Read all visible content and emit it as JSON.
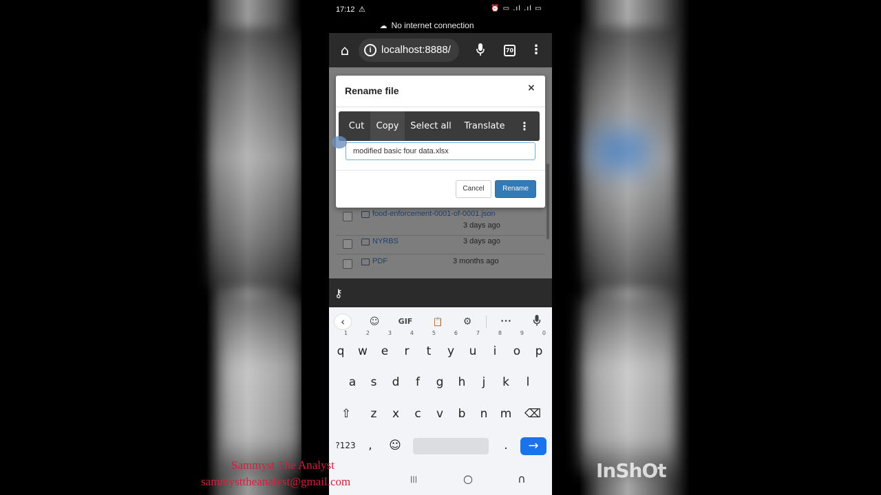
{
  "status_bar": {
    "time": "17:12",
    "warning_glyph": "⚠",
    "right_icons": "⏰ ▭ .ıl .ıl ▭"
  },
  "network_banner": {
    "icon": "cloud-off-icon",
    "text": "No internet connection"
  },
  "browser": {
    "url": "localhost:8888/",
    "tab_count": "70",
    "home_glyph": "⌂",
    "mic_glyph": "🎤",
    "menu_glyph": "⋮",
    "info_glyph": "i"
  },
  "file_list": [
    {
      "name": "food-enforcement-0001-of-0001.json",
      "modified": "3 days ago"
    },
    {
      "name": "NYRBS",
      "modified": "3 days ago"
    },
    {
      "name": "PDF",
      "modified": "3 months ago"
    }
  ],
  "dialog": {
    "title": "Rename file",
    "close_glyph": "×",
    "input_value": "modified basic four data.xlsx",
    "cancel_label": "Cancel",
    "rename_label": "Rename"
  },
  "context_menu": {
    "items": [
      "Cut",
      "Copy",
      "Select all",
      "Translate"
    ],
    "more_glyph": "⋮"
  },
  "keyboard": {
    "toolbar": {
      "back": "‹",
      "sticker": "☺",
      "gif": "GIF",
      "clipboard": "📋",
      "settings": "⚙",
      "more": "•••",
      "mic": "🎤"
    },
    "row1": [
      "q",
      "w",
      "e",
      "r",
      "t",
      "y",
      "u",
      "i",
      "o",
      "p"
    ],
    "row1_digits": [
      "1",
      "2",
      "3",
      "4",
      "5",
      "6",
      "7",
      "8",
      "9",
      "0"
    ],
    "row2": [
      "a",
      "s",
      "d",
      "f",
      "g",
      "h",
      "j",
      "k",
      "l"
    ],
    "row3": [
      "z",
      "x",
      "c",
      "v",
      "b",
      "n",
      "m"
    ],
    "shift": "⇧",
    "backspace": "⌫",
    "symbols": "?123",
    "comma": ",",
    "emoji": "☺",
    "period": ".",
    "enter": "→",
    "nav": {
      "recents": "|||",
      "home": "○",
      "back": "∩"
    },
    "key_glyph": "⚷"
  },
  "credits": {
    "name": "Sammyst The Analyst",
    "email": "sammysttheanalyst@gmail.com"
  },
  "watermark": "InShOt",
  "colors": {
    "primary_button": "#337ab7",
    "enter_key": "#1a73e8",
    "credit_text": "#d0213a"
  }
}
